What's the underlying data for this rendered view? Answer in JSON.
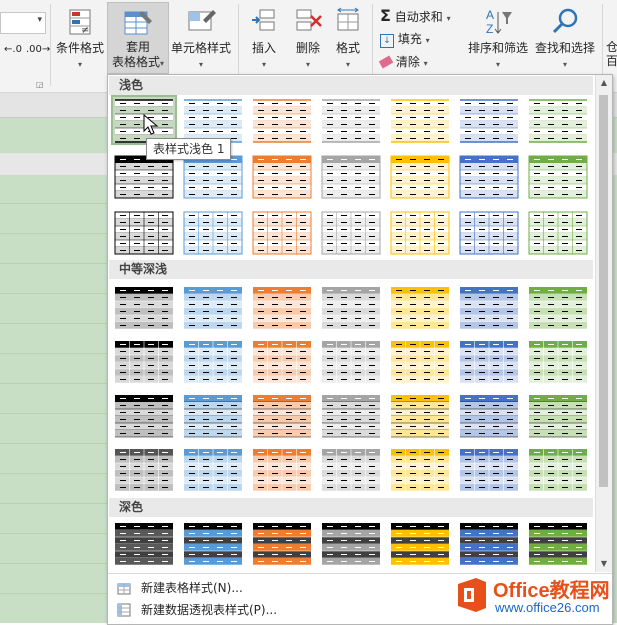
{
  "ribbon": {
    "conditional_format": "条件格式",
    "table_format_line1": "套用",
    "table_format_line2": "表格格式",
    "cell_styles": "单元格样式",
    "insert": "插入",
    "delete": "删除",
    "format": "格式",
    "autosum": "自动求和",
    "fill": "填充",
    "clear": "清除",
    "sort_filter": "排序和筛选",
    "find_select": "查找和选择",
    "decimal_inc": ".00",
    "decimal_dec": ".0",
    "edge_text_1": "仓",
    "edge_text_2": "百"
  },
  "gallery": {
    "section_light": "浅色",
    "section_medium": "中等深浅",
    "section_dark": "深色",
    "tooltip": "表样式浅色 1",
    "accent_colors": [
      "#000000",
      "#5b9bd5",
      "#ed7d31",
      "#a5a5a5",
      "#ffc000",
      "#4472c4",
      "#70ad47"
    ],
    "light_tints": [
      "#d9d9d9",
      "#ddebf7",
      "#fce4d6",
      "#ededed",
      "#fff2cc",
      "#d9e1f2",
      "#e2efda"
    ],
    "medium_tints": [
      "#bfbfbf",
      "#bdd7ee",
      "#f8cbad",
      "#dbdbdb",
      "#ffe699",
      "#b4c6e7",
      "#c6e0b4"
    ],
    "selected_style_bg": "#c6d9c0"
  },
  "menu": {
    "new_table_style": "新建表格样式(N)...",
    "new_pivot_style": "新建数据透视表样式(P)..."
  },
  "watermark": {
    "brand": "Office教程网",
    "url": "www.office26.com",
    "brand_color": "#e8501a"
  }
}
